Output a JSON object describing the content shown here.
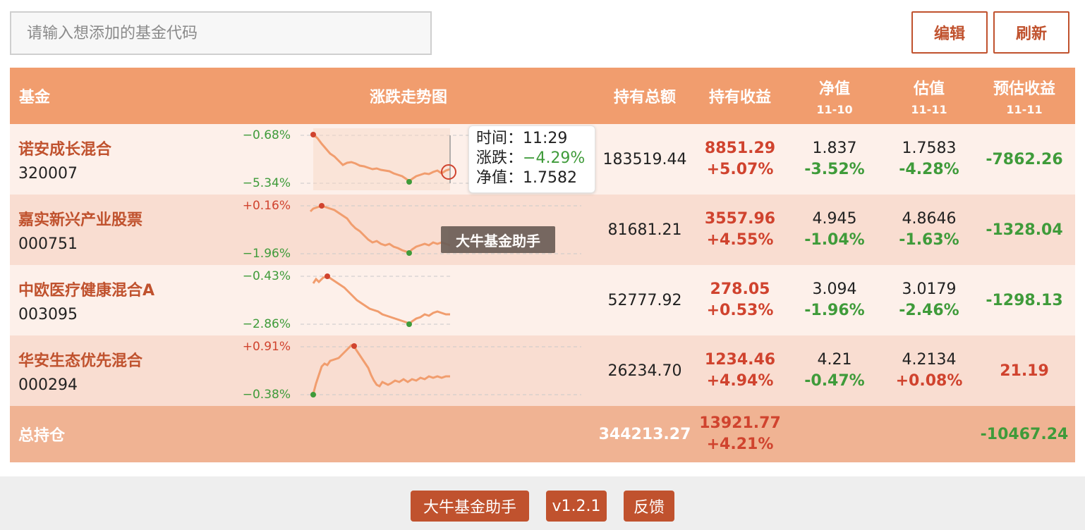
{
  "search": {
    "placeholder": "请输入想添加的基金代码"
  },
  "toolbar": {
    "edit_label": "编辑",
    "refresh_label": "刷新"
  },
  "header": {
    "fund": "基金",
    "trend": "涨跌走势图",
    "holding_total": "持有总额",
    "holding_profit": "持有收益",
    "nav": {
      "label": "净值",
      "date": "11-10"
    },
    "estimate": {
      "label": "估值",
      "date": "11-11"
    },
    "est_profit": {
      "label": "预估收益",
      "date": "11-11"
    }
  },
  "funds": [
    {
      "name": "诺安成长混合",
      "code": "320007",
      "chart_top": "−0.68%",
      "chart_bottom": "−5.34%",
      "total": "183519.44",
      "profit": "8851.29",
      "profit_pct": "+5.07%",
      "nav": "1.837",
      "nav_change": "-3.52%",
      "est": "1.7583",
      "est_change": "-4.28%",
      "est_profit": "-7862.26"
    },
    {
      "name": "嘉实新兴产业股票",
      "code": "000751",
      "chart_top": "+0.16%",
      "chart_bottom": "−1.96%",
      "total": "81681.21",
      "profit": "3557.96",
      "profit_pct": "+4.55%",
      "nav": "4.945",
      "nav_change": "-1.04%",
      "est": "4.8646",
      "est_change": "-1.63%",
      "est_profit": "-1328.04"
    },
    {
      "name": "中欧医疗健康混合A",
      "code": "003095",
      "chart_top": "−0.43%",
      "chart_bottom": "−2.86%",
      "total": "52777.92",
      "profit": "278.05",
      "profit_pct": "+0.53%",
      "nav": "3.094",
      "nav_change": "-1.96%",
      "est": "3.0179",
      "est_change": "-2.46%",
      "est_profit": "-1298.13"
    },
    {
      "name": "华安生态优先混合",
      "code": "000294",
      "chart_top": "+0.91%",
      "chart_bottom": "−0.38%",
      "total": "26234.70",
      "profit": "1234.46",
      "profit_pct": "+4.94%",
      "nav": "4.21",
      "nav_change": "-0.47%",
      "est": "4.2134",
      "est_change": "+0.08%",
      "est_profit": "21.19"
    }
  ],
  "total_row": {
    "label": "总持仓",
    "total": "344213.27",
    "profit": "13921.77",
    "profit_pct": "+4.21%",
    "est_profit": "-10467.24"
  },
  "tooltip": {
    "time_label": "时间：",
    "time": "11:29",
    "change_label": "涨跌：",
    "change": "−4.29%",
    "nav_label": "净值：",
    "nav": "1.7582"
  },
  "watermark": "大牛基金助手",
  "footer": {
    "app_label": "大牛基金助手",
    "version": "v1.2.1",
    "feedback": "反馈"
  },
  "colors": {
    "accent": "#c0522e",
    "header": "#f19d6e",
    "up": "#d0432e",
    "down": "#3f9b3a",
    "line": "#f19d6e"
  }
}
